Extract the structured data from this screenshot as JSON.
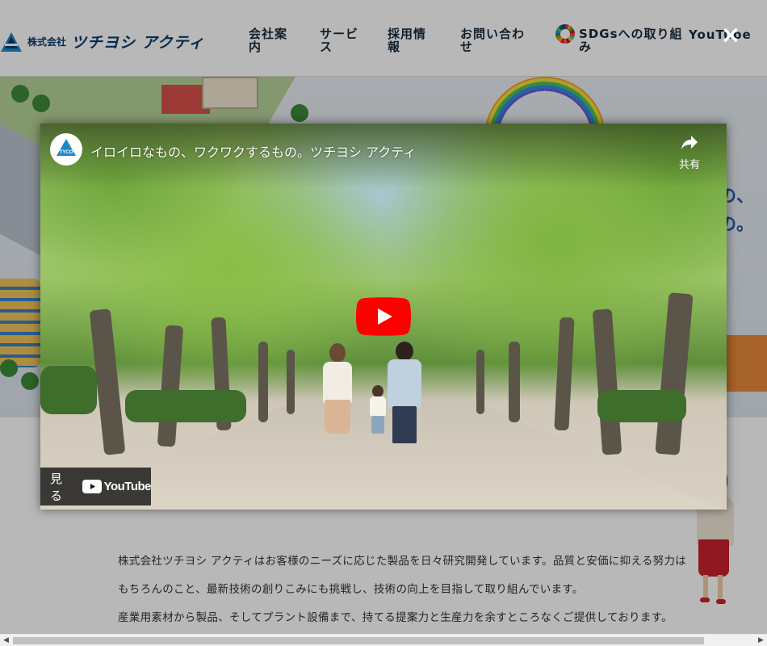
{
  "header": {
    "logo_small": "株式会社",
    "logo_big": "ツチヨシ アクティ",
    "nav": [
      {
        "label": "会社案内"
      },
      {
        "label": "サービス"
      },
      {
        "label": "採用情報"
      },
      {
        "label": "お問い合わせ"
      },
      {
        "label": "SDGsへの取り組み"
      },
      {
        "label": "YouTube"
      }
    ]
  },
  "hero": {
    "tagline_1": "の、",
    "tagline_2": "の。"
  },
  "intro": {
    "lines": [
      "株式会社ツチヨシ アクティはお客様のニーズに応じた製品を日々研究開発しています。品質と安価に抑える努力は",
      "もちろんのこと、最新技術の創りこみにも挑戦し、技術の向上を目指して取り組んでいます。",
      "産業用素材から製品、そしてプラント設備まで、持てる提案力と生産力を余すところなくご提供しております。"
    ]
  },
  "modal": {
    "close_label": "×",
    "video": {
      "channel_avatar_text": "TYCO",
      "title": "イロイロなもの、ワクワクするもの。ツチヨシ アクティ",
      "share_label": "共有",
      "watch_label": "見る",
      "youtube_wordmark": "YouTube"
    }
  },
  "icons": {
    "close": "close-icon",
    "share": "share-icon",
    "play": "play-icon",
    "youtube_logo": "youtube-logo-icon",
    "sdgs": "sdgs-wheel-icon",
    "scroll_left": "scroll-left-icon",
    "scroll_right": "scroll-right-icon"
  },
  "colors": {
    "brand_navy": "#0c3b6e",
    "brand_blue": "#1e88c8",
    "youtube_red": "#ff0000",
    "overlay": "rgba(0,0,0,0.28)"
  }
}
